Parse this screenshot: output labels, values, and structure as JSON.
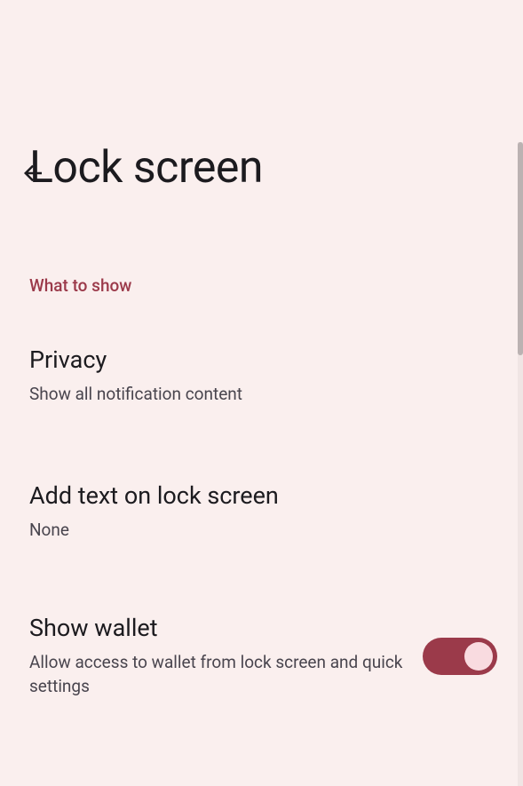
{
  "header": {
    "title": "Lock screen"
  },
  "section": {
    "label": "What to show"
  },
  "rows": [
    {
      "title": "Privacy",
      "subtitle": "Show all notification content"
    },
    {
      "title": "Add text on lock screen",
      "subtitle": "None"
    },
    {
      "title": "Show wallet",
      "subtitle": "Allow access to wallet from lock screen and quick settings",
      "enabled": true
    }
  ]
}
